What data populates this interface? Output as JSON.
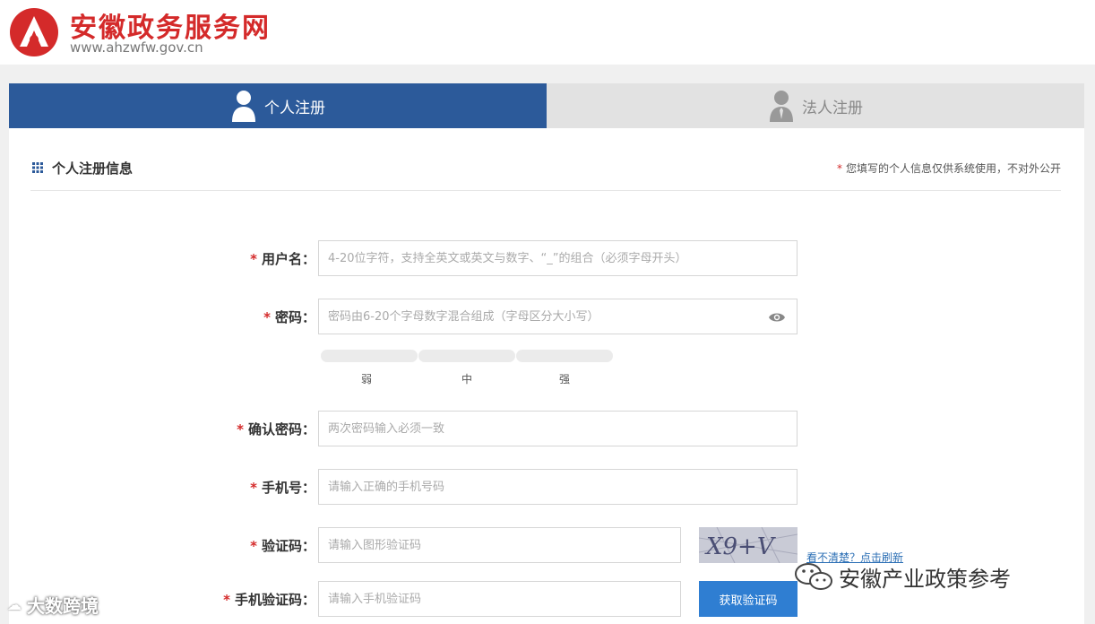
{
  "header": {
    "site_title": "安徽政务服务网",
    "site_url": "www.ahzwfw.gov.cn"
  },
  "tabs": [
    {
      "label": "个人注册",
      "active": true
    },
    {
      "label": "法人注册",
      "active": false
    }
  ],
  "section": {
    "title": "个人注册信息",
    "privacy_star": "*",
    "privacy_note": "您填写的个人信息仅供系统使用，不对外公开"
  },
  "form": {
    "required_mark": "*",
    "username": {
      "label": "用户名：",
      "placeholder": "4-20位字符，支持全英文或英文与数字、“_”的组合（必须字母开头）"
    },
    "password": {
      "label": "密码：",
      "placeholder": "密码由6-20个字母数字混合组成（字母区分大小写）"
    },
    "strength": {
      "weak": "弱",
      "medium": "中",
      "strong": "强"
    },
    "confirm_password": {
      "label": "确认密码：",
      "placeholder": "两次密码输入必须一致"
    },
    "phone": {
      "label": "手机号：",
      "placeholder": "请输入正确的手机号码"
    },
    "captcha": {
      "label": "验证码：",
      "placeholder": "请输入图形验证码",
      "image_text": "X9+V",
      "refresh_link": "看不清楚？点击刷新"
    },
    "sms_code": {
      "label": "手机验证码：",
      "placeholder": "请输入手机验证码",
      "button": "获取验证码"
    }
  },
  "watermarks": {
    "right": "安徽产业政策参考",
    "left": "大数跨境"
  },
  "colors": {
    "brand_red": "#d42a2a",
    "tab_active": "#2c5a9a",
    "button_blue": "#2f7ed2"
  }
}
